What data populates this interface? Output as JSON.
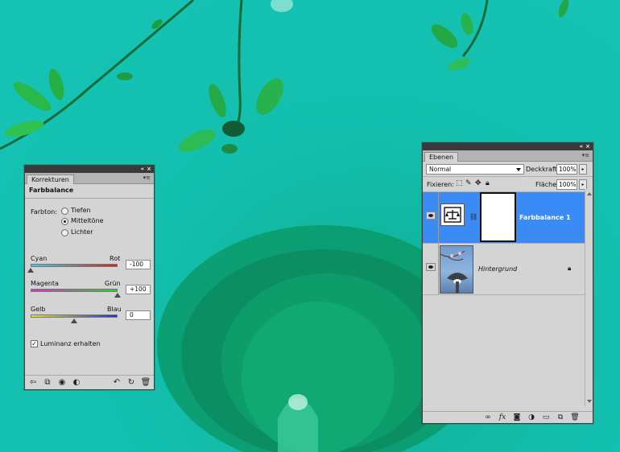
{
  "korrekturen": {
    "tab_label": "Korrekturen",
    "title": "Farbbalance",
    "farbton_label": "Farbton:",
    "tones": [
      {
        "label": "Tiefen",
        "selected": false
      },
      {
        "label": "Mitteltöne",
        "selected": true
      },
      {
        "label": "Lichter",
        "selected": false
      }
    ],
    "sliders": [
      {
        "left_label": "Cyan",
        "right_label": "Rot",
        "value": "-100",
        "level": -100,
        "colors": [
          "#2fd6e8",
          "#e21b1b"
        ]
      },
      {
        "left_label": "Magenta",
        "right_label": "Grün",
        "value": "+100",
        "level": 100,
        "colors": [
          "#d62fd6",
          "#2bd12b"
        ]
      },
      {
        "left_label": "Gelb",
        "right_label": "Blau",
        "value": "0",
        "level": 0,
        "colors": [
          "#e8e22a",
          "#1b2fd6"
        ]
      }
    ],
    "luminance_label": "Luminanz erhalten",
    "luminance_checked": true,
    "footer_icons": [
      "back-arrow-icon",
      "clip-layer-icon",
      "eye-state-icon",
      "visibility-icon",
      "previous-state-icon",
      "reset-icon",
      "trash-icon"
    ]
  },
  "ebenen": {
    "tab_label": "Ebenen",
    "blend_mode": "Normal",
    "opacity_label": "Deckkraft:",
    "opacity_value": "100%",
    "lock_label": "Fixieren:",
    "fill_label": "Fläche:",
    "fill_value": "100%",
    "layers": [
      {
        "name": "Farbbalance 1",
        "selected": true
      },
      {
        "name": "Hintergrund",
        "selected": false
      }
    ],
    "footer_icons": [
      "link-icon",
      "fx-icon",
      "mask-icon",
      "adjustment-icon",
      "group-icon",
      "new-layer-icon",
      "trash-icon"
    ]
  },
  "colors": {
    "selection": "#3a8bf5",
    "panel_bg": "#d4d4d4",
    "photo_teal": "#12c1b2"
  }
}
